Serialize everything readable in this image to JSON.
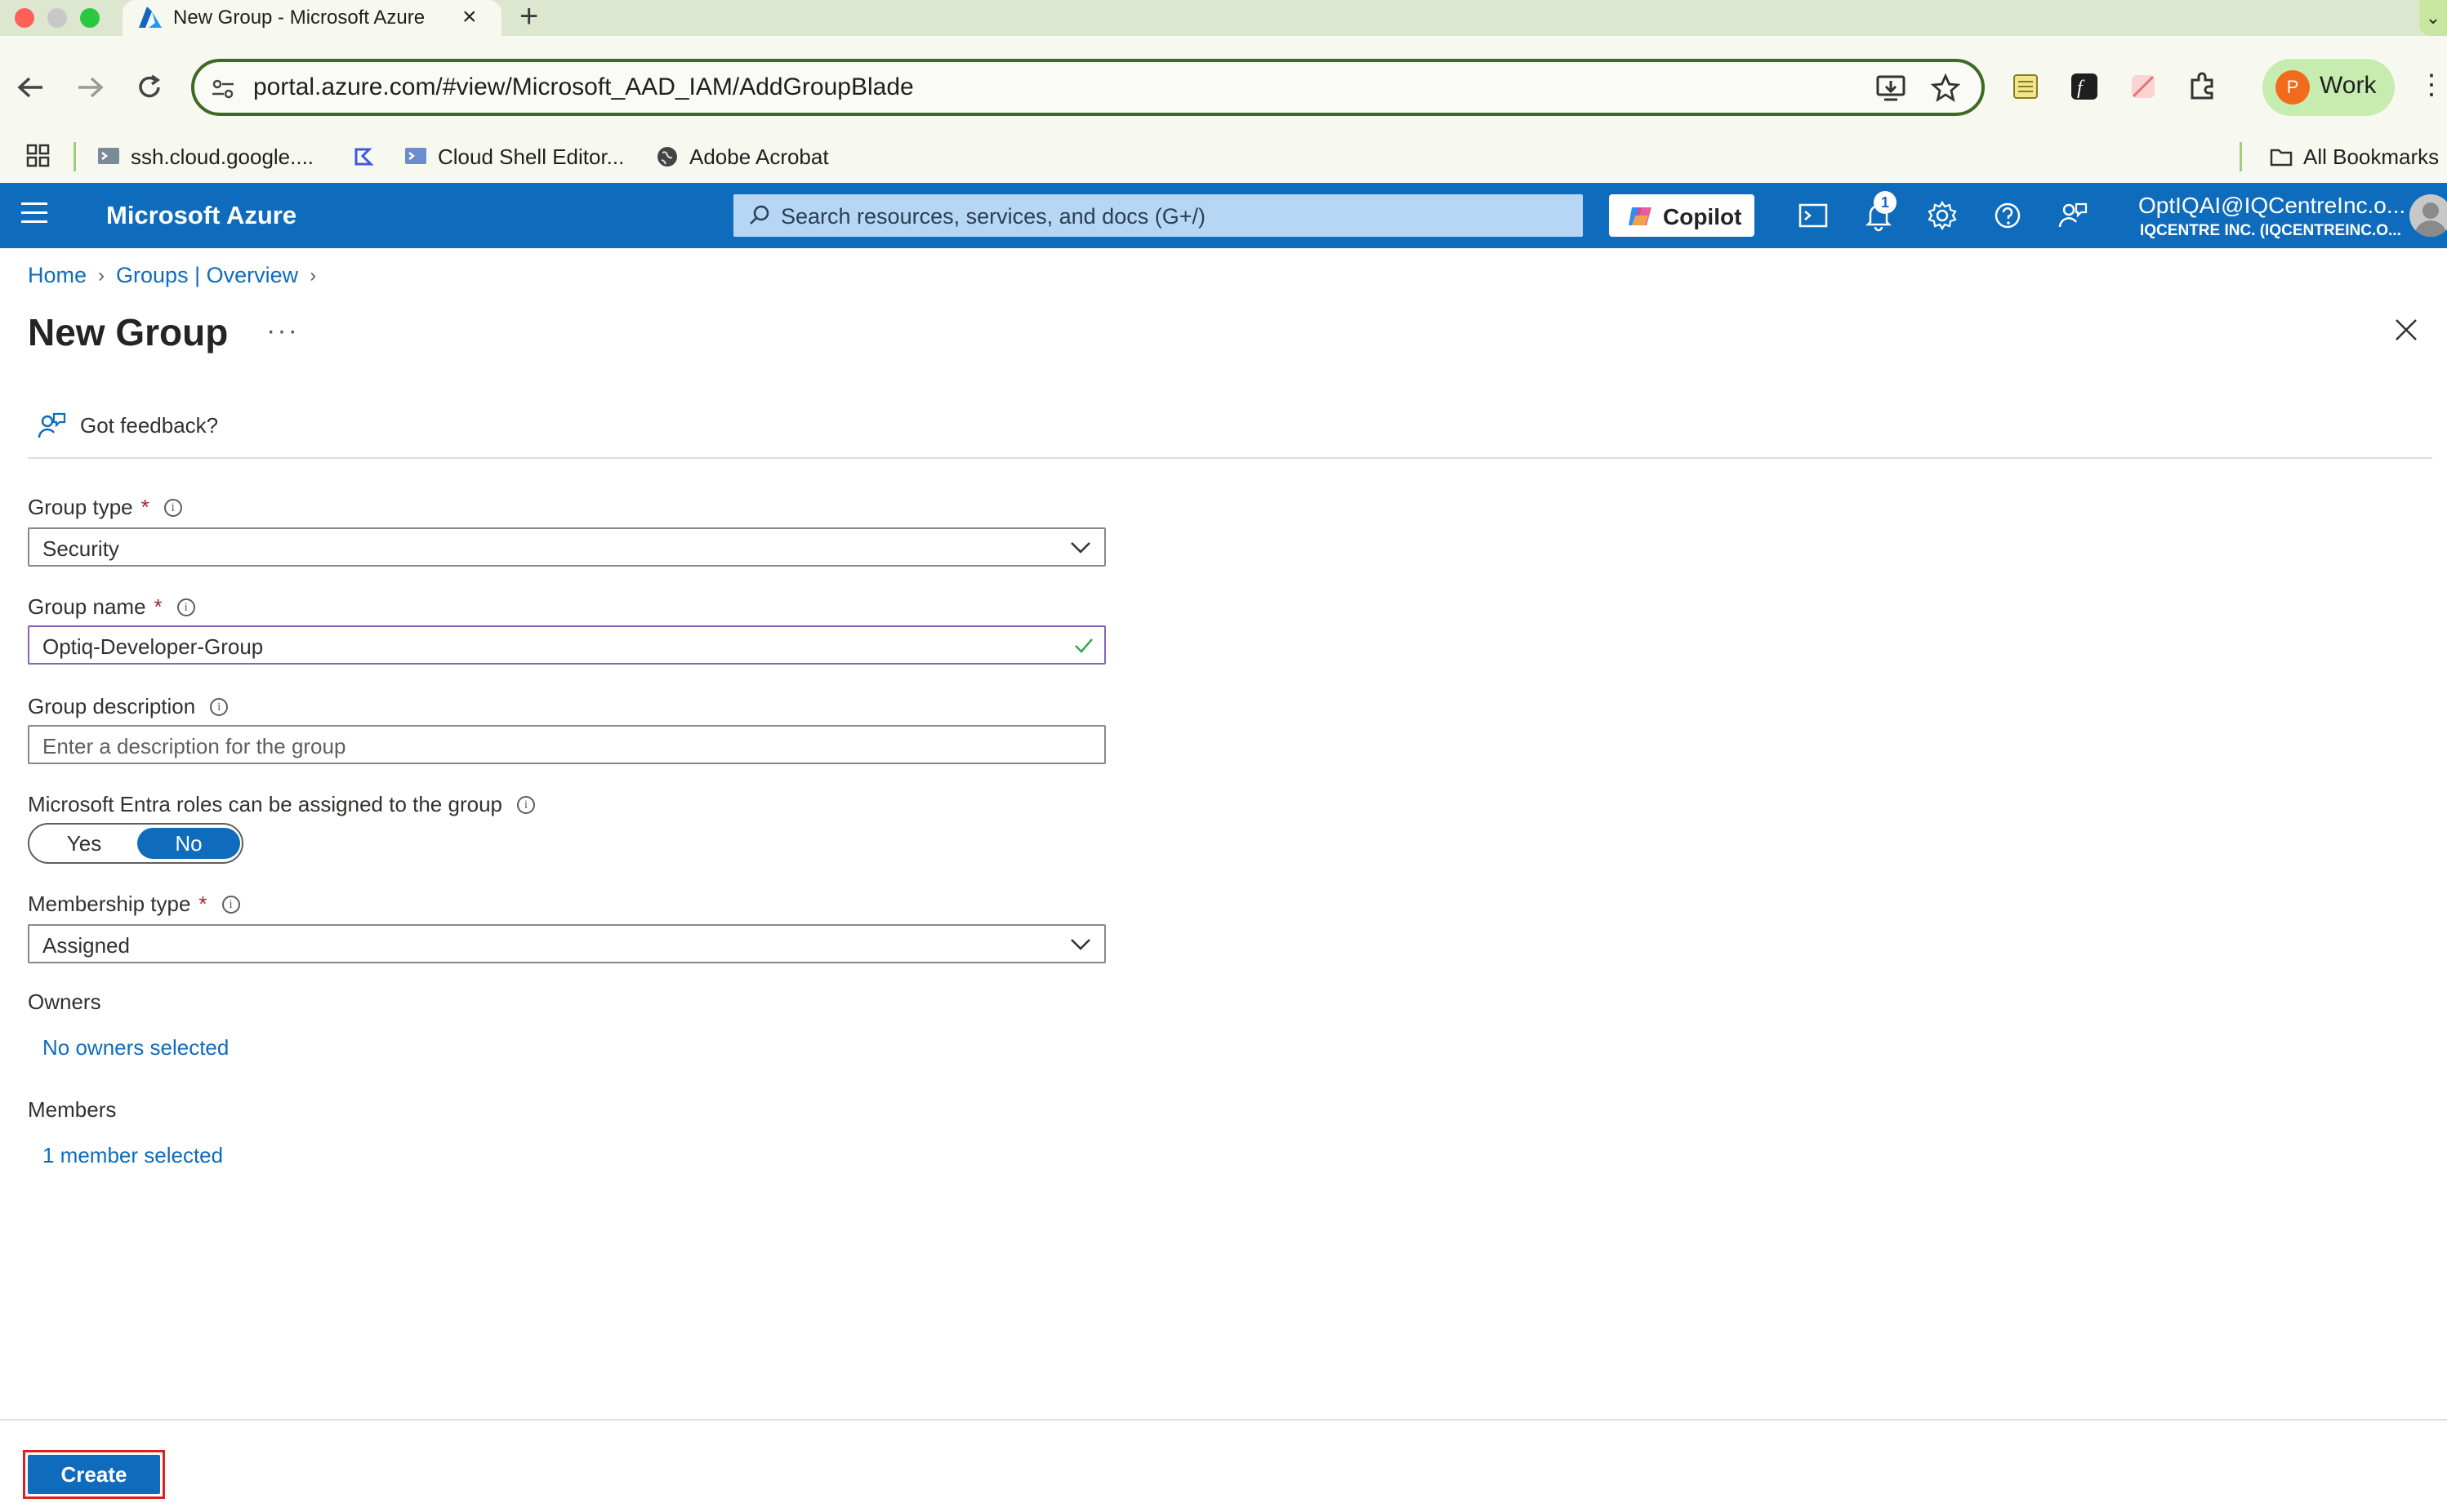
{
  "browser": {
    "tab_title": "New Group - Microsoft Azure",
    "url": "portal.azure.com/#view/Microsoft_AAD_IAM/AddGroupBlade",
    "profile_label": "Work",
    "profile_initial": "P",
    "bookmarks": [
      {
        "label": "ssh.cloud.google...."
      },
      {
        "label": ""
      },
      {
        "label": "Cloud Shell Editor..."
      },
      {
        "label": "Adobe Acrobat"
      }
    ],
    "all_bookmarks_label": "All Bookmarks"
  },
  "azure_header": {
    "brand": "Microsoft Azure",
    "search_placeholder": "Search resources, services, and docs (G+/)",
    "copilot_label": "Copilot",
    "notification_count": "1",
    "account_name": "OptIQAI@IQCentreInc.o...",
    "account_tenant": "IQCENTRE INC. (IQCENTREINC.O..."
  },
  "breadcrumb": [
    {
      "label": "Home"
    },
    {
      "label": "Groups | Overview"
    }
  ],
  "page": {
    "title": "New Group",
    "more_label": "···",
    "feedback_label": "Got feedback?"
  },
  "form": {
    "group_type": {
      "label": "Group type",
      "required": "*",
      "value": "Security"
    },
    "group_name": {
      "label": "Group name",
      "required": "*",
      "value": "Optiq-Developer-Group"
    },
    "group_description": {
      "label": "Group description",
      "placeholder": "Enter a description for the group"
    },
    "entra_roles": {
      "label": "Microsoft Entra roles can be assigned to the group",
      "options": [
        "Yes",
        "No"
      ],
      "selected": "No"
    },
    "membership_type": {
      "label": "Membership type",
      "required": "*",
      "value": "Assigned"
    },
    "owners": {
      "label": "Owners",
      "link": "No owners selected"
    },
    "members": {
      "label": "Members",
      "link": "1 member selected"
    }
  },
  "footer": {
    "create_label": "Create"
  },
  "colors": {
    "azure_blue": "#0f6cbd",
    "required_red": "#a4262c",
    "focus_purple": "#8764b8",
    "highlight_red": "#e02020"
  }
}
